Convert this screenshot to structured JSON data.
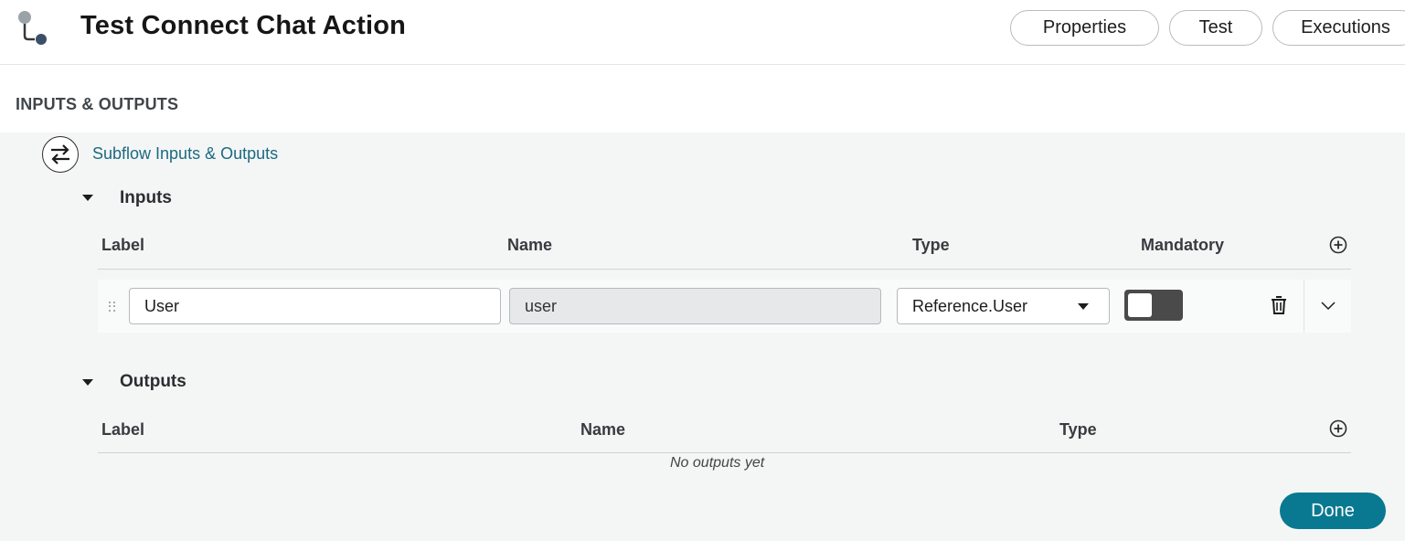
{
  "header": {
    "title": "Test Connect Chat Action",
    "app_icon": "subflow-logo-icon",
    "tabs": [
      {
        "label": "Properties"
      },
      {
        "label": "Test"
      },
      {
        "label": "Executions"
      }
    ]
  },
  "section": {
    "title": "INPUTS & OUTPUTS",
    "subflow_link": "Subflow Inputs & Outputs",
    "subflow_icon": "swap-arrows-icon"
  },
  "inputs": {
    "title": "Inputs",
    "columns": [
      "Label",
      "Name",
      "Type",
      "Mandatory"
    ],
    "rows": [
      {
        "label": "User",
        "name": "user",
        "type": "Reference.User",
        "mandatory": false
      }
    ]
  },
  "outputs": {
    "title": "Outputs",
    "columns": [
      "Label",
      "Name",
      "Type"
    ],
    "empty_text": "No outputs yet"
  },
  "footer": {
    "done_label": "Done"
  },
  "colors": {
    "accent": "#087990",
    "link": "#1b6a80",
    "panel_bg": "#f4f6f6",
    "toggle_bg": "#4a4a4a"
  }
}
